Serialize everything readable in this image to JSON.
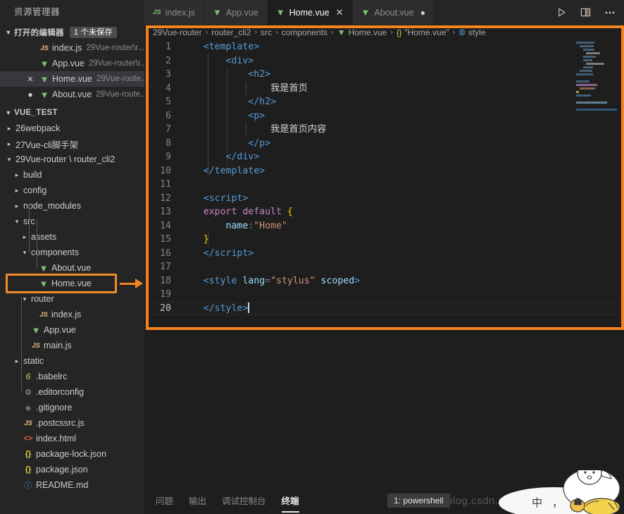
{
  "sidebar": {
    "title": "资源管理器",
    "open_editors": {
      "label": "打开的编辑器",
      "badge": "1 个未保存",
      "items": [
        {
          "icon": "js-file-icon",
          "name": "index.js",
          "path": "29Vue-router\\r...",
          "state": "",
          "selected": false
        },
        {
          "icon": "vue-file-icon",
          "name": "App.vue",
          "path": "29Vue-router\\r...",
          "state": "",
          "selected": false
        },
        {
          "icon": "vue-file-icon",
          "name": "Home.vue",
          "path": "29Vue-route...",
          "state": "close",
          "selected": true
        },
        {
          "icon": "vue-file-icon",
          "name": "About.vue",
          "path": "29Vue-route...",
          "state": "dirty",
          "selected": false
        }
      ]
    },
    "workspace": {
      "label": "VUE_TEST",
      "tree": [
        {
          "label": "26webpack",
          "depth": 1,
          "type": "folder",
          "expanded": false
        },
        {
          "label": "27Vue-cli脚手架",
          "depth": 1,
          "type": "folder",
          "expanded": false
        },
        {
          "label": "29Vue-router \\ router_cli2",
          "depth": 1,
          "type": "folder",
          "expanded": true
        },
        {
          "label": "build",
          "depth": 2,
          "type": "folder",
          "expanded": false
        },
        {
          "label": "config",
          "depth": 2,
          "type": "folder",
          "expanded": false
        },
        {
          "label": "node_modules",
          "depth": 2,
          "type": "folder",
          "expanded": false
        },
        {
          "label": "src",
          "depth": 2,
          "type": "folder",
          "expanded": true
        },
        {
          "label": "assets",
          "depth": 3,
          "type": "folder",
          "expanded": false
        },
        {
          "label": "components",
          "depth": 3,
          "type": "folder",
          "expanded": true
        },
        {
          "label": "About.vue",
          "depth": 4,
          "type": "file",
          "icon": "vue-file-icon"
        },
        {
          "label": "Home.vue",
          "depth": 4,
          "type": "file",
          "icon": "vue-file-icon",
          "highlighted": true
        },
        {
          "label": "router",
          "depth": 3,
          "type": "folder",
          "expanded": true
        },
        {
          "label": "index.js",
          "depth": 4,
          "type": "file",
          "icon": "js-file-icon"
        },
        {
          "label": "App.vue",
          "depth": 3,
          "type": "file",
          "icon": "vue-file-icon"
        },
        {
          "label": "main.js",
          "depth": 3,
          "type": "file",
          "icon": "js-file-icon"
        },
        {
          "label": "static",
          "depth": 2,
          "type": "folder",
          "expanded": false
        },
        {
          "label": ".babelrc",
          "depth": 2,
          "type": "file",
          "icon": "babel-icon"
        },
        {
          "label": ".editorconfig",
          "depth": 2,
          "type": "file",
          "icon": "gear-icon"
        },
        {
          "label": ".gitignore",
          "depth": 2,
          "type": "file",
          "icon": "git-icon"
        },
        {
          "label": ".postcssrc.js",
          "depth": 2,
          "type": "file",
          "icon": "js-file-icon"
        },
        {
          "label": "index.html",
          "depth": 2,
          "type": "file",
          "icon": "html-icon"
        },
        {
          "label": "package-lock.json",
          "depth": 2,
          "type": "file",
          "icon": "json-icon"
        },
        {
          "label": "package.json",
          "depth": 2,
          "type": "file",
          "icon": "json-icon"
        },
        {
          "label": "README.md",
          "depth": 2,
          "type": "file",
          "icon": "markdown-icon"
        }
      ]
    }
  },
  "tabs": [
    {
      "label": "index.js",
      "icon": "js-file-icon",
      "active": false,
      "state": ""
    },
    {
      "label": "App.vue",
      "icon": "vue-file-icon",
      "active": false,
      "state": ""
    },
    {
      "label": "Home.vue",
      "icon": "vue-file-icon",
      "active": true,
      "state": "close"
    },
    {
      "label": "About.vue",
      "icon": "vue-file-icon",
      "active": false,
      "state": "dirty"
    }
  ],
  "tab_actions": [
    {
      "name": "run-button",
      "glyph": "▷"
    },
    {
      "name": "split-editor-button",
      "glyph": "▯"
    },
    {
      "name": "more-actions-button",
      "glyph": "⋯"
    }
  ],
  "breadcrumb": [
    {
      "label": "29Vue-router",
      "icon": ""
    },
    {
      "label": "router_cli2",
      "icon": ""
    },
    {
      "label": "src",
      "icon": ""
    },
    {
      "label": "components",
      "icon": ""
    },
    {
      "label": "Home.vue",
      "icon": "vue-file-icon"
    },
    {
      "label": "\"Home.vue\"",
      "icon": "json-icon"
    },
    {
      "label": "style",
      "icon": "style-symbol-icon"
    }
  ],
  "editor": {
    "filename": "Home.vue",
    "cursor_line": 20,
    "lines": [
      {
        "n": 1,
        "tokens": [
          {
            "t": "tag",
            "v": "    <template>"
          }
        ]
      },
      {
        "n": 2,
        "tokens": [
          {
            "t": "tag",
            "v": "        <div>"
          }
        ]
      },
      {
        "n": 3,
        "tokens": [
          {
            "t": "tag",
            "v": "            <h2>"
          }
        ]
      },
      {
        "n": 4,
        "tokens": [
          {
            "t": "plain",
            "v": "                我是首页"
          }
        ]
      },
      {
        "n": 5,
        "tokens": [
          {
            "t": "tag",
            "v": "            </h2>"
          }
        ]
      },
      {
        "n": 6,
        "tokens": [
          {
            "t": "tag",
            "v": "            <p>"
          }
        ]
      },
      {
        "n": 7,
        "tokens": [
          {
            "t": "plain",
            "v": "                我是首页内容"
          }
        ]
      },
      {
        "n": 8,
        "tokens": [
          {
            "t": "tag",
            "v": "            </p>"
          }
        ]
      },
      {
        "n": 9,
        "tokens": [
          {
            "t": "tag",
            "v": "        </div>"
          }
        ]
      },
      {
        "n": 10,
        "tokens": [
          {
            "t": "tag",
            "v": "    </template>"
          }
        ]
      },
      {
        "n": 11,
        "tokens": [
          {
            "t": "plain",
            "v": ""
          }
        ]
      },
      {
        "n": 12,
        "tokens": [
          {
            "t": "tag",
            "v": "    <script>"
          }
        ]
      },
      {
        "n": 13,
        "tokens": [
          {
            "t": "kw",
            "v": "    export default "
          },
          {
            "t": "brace",
            "v": "{"
          }
        ]
      },
      {
        "n": 14,
        "tokens": [
          {
            "t": "prop",
            "v": "        name"
          },
          {
            "t": "punct",
            "v": ":"
          },
          {
            "t": "str",
            "v": "\"Home\""
          }
        ]
      },
      {
        "n": 15,
        "tokens": [
          {
            "t": "brace",
            "v": "    }"
          }
        ]
      },
      {
        "n": 16,
        "tokens": [
          {
            "t": "tag",
            "v": "    </script>"
          }
        ]
      },
      {
        "n": 17,
        "tokens": [
          {
            "t": "plain",
            "v": ""
          }
        ]
      },
      {
        "n": 18,
        "tokens": [
          {
            "t": "tag",
            "v": "    <style "
          },
          {
            "t": "attr",
            "v": "lang"
          },
          {
            "t": "punct",
            "v": "="
          },
          {
            "t": "str",
            "v": "\"stylus\""
          },
          {
            "t": "attr",
            "v": " scoped"
          },
          {
            "t": "tag",
            "v": ">"
          }
        ]
      },
      {
        "n": 19,
        "tokens": [
          {
            "t": "plain",
            "v": ""
          }
        ]
      },
      {
        "n": 20,
        "tokens": [
          {
            "t": "tag",
            "v": "    </style>"
          }
        ],
        "cursor": true
      }
    ]
  },
  "panel": {
    "tabs": [
      {
        "label": "问题",
        "active": false
      },
      {
        "label": "输出",
        "active": false
      },
      {
        "label": "调试控制台",
        "active": false
      },
      {
        "label": "终端",
        "active": true
      }
    ],
    "terminal_selector": "1: powershell"
  },
  "watermark": "https://blog.csdn.net/Ww...lin...",
  "ime": {
    "mode": "中",
    "punct": "，",
    "glyph": "⬛"
  },
  "colors": {
    "accent_orange": "#f58220",
    "editor_bg": "#1e1e1e",
    "sidebar_bg": "#252526",
    "tab_inactive_bg": "#2d2d2d",
    "selection_bg": "#37373d",
    "vue_green": "#7ac46b",
    "tag_blue": "#569cd6",
    "string_orange": "#ce9178",
    "keyword_purple": "#c586c0"
  }
}
